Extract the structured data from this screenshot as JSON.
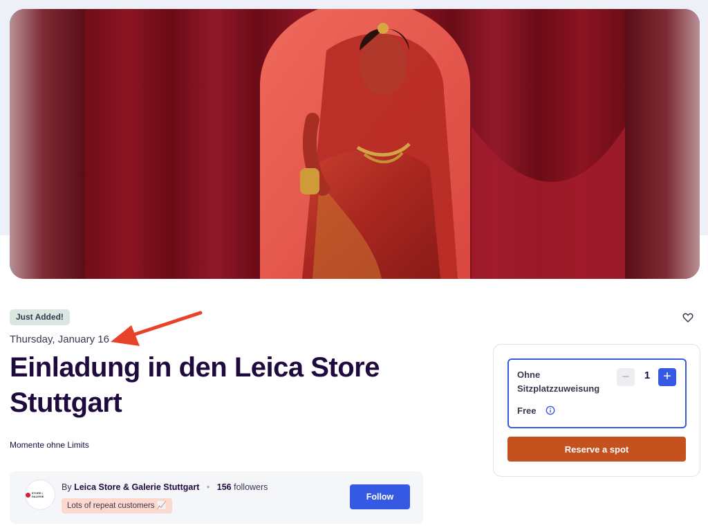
{
  "event": {
    "badge": "Just Added!",
    "date": "Thursday, January 16",
    "title": "Einladung in den Leica Store Stuttgart",
    "summary": "Momente ohne Limits"
  },
  "organizer": {
    "by_prefix": "By",
    "name": "Leica Store & Galerie Stuttgart",
    "followers_count": "156",
    "followers_label": "followers",
    "tag": "Lots of repeat customers 📈",
    "follow_label": "Follow",
    "logo_text": "STORE | GALERIE"
  },
  "ticket": {
    "name": "Ohne Sitzplatzzuweisung",
    "price": "Free",
    "quantity": "1",
    "minus_symbol": "−",
    "plus_symbol": "+",
    "reserve_label": "Reserve a spot"
  },
  "icons": {
    "like": "heart-icon",
    "info": "info-icon",
    "annotation": "red-arrow"
  },
  "colors": {
    "primary_blue": "#3659e3",
    "cta_orange": "#c5511f",
    "badge_green": "#d8e8e1",
    "tag_peach": "#fbd9cf",
    "annotation_red": "#e8432a"
  }
}
